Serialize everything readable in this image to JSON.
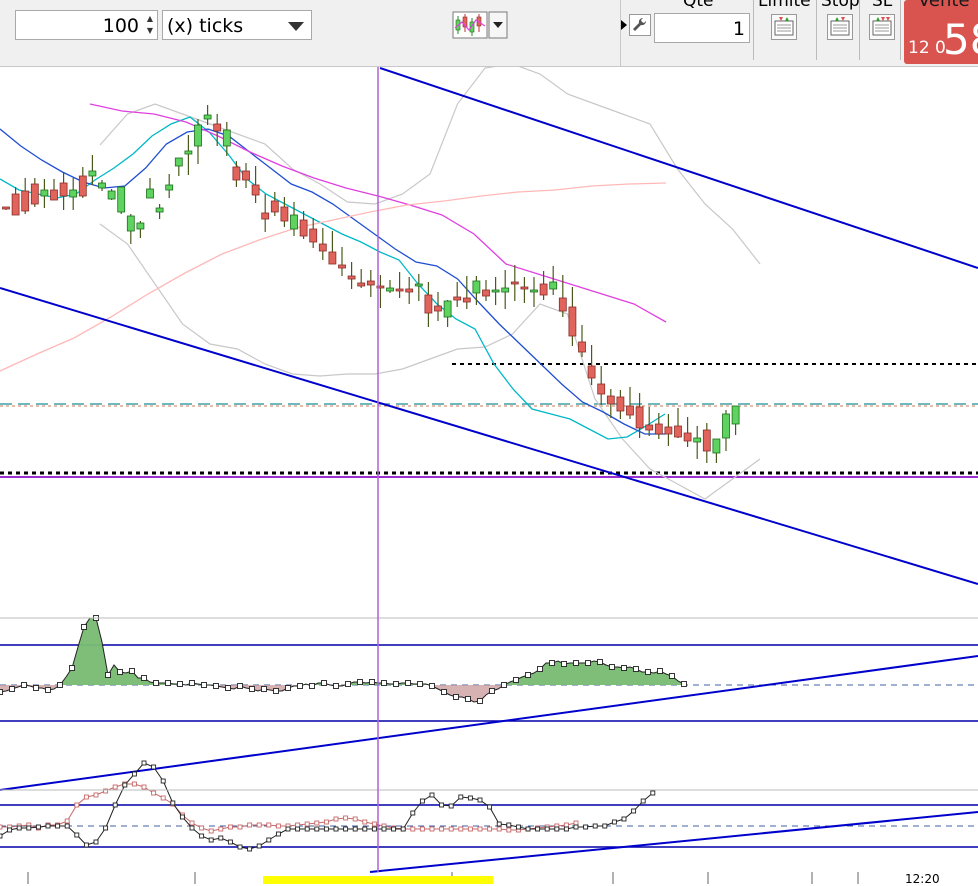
{
  "toolbar": {
    "count_value": "100",
    "unit_label": "(x) ticks",
    "indicator_button": "indicator-selector-icon"
  },
  "order_panel": {
    "qty_header": "Qté",
    "qty_value": "1",
    "limit_header": "Limite",
    "stop_header": "Stop",
    "sl_header": "SL",
    "sell_header": "Vente",
    "sell_price_small": "12 0",
    "sell_price_big": "58"
  },
  "axis": {
    "date_label": "12:20"
  },
  "colors": {
    "bull": "#5fd35f",
    "bear": "#e0645c",
    "trend_line": "#0000cc",
    "ma_fast": "#00b8c8",
    "ma_mid": "#1f4fd0",
    "ma_slow": "#e040e0",
    "ma_long": "#ffb8b8",
    "band": "#c8c8c8",
    "cursor": "#b060d8"
  },
  "chart_data": [
    {
      "type": "candlestick",
      "title": "",
      "candles": [
        {
          "o": 57,
          "h": 55,
          "l": 54,
          "c": 56
        },
        {
          "o": 70,
          "h": 77,
          "l": 49,
          "c": 49
        },
        {
          "o": 73,
          "h": 86,
          "l": 50,
          "c": 53
        },
        {
          "o": 80,
          "h": 86,
          "l": 57,
          "c": 60
        },
        {
          "o": 68,
          "h": 85,
          "l": 56,
          "c": 74
        },
        {
          "o": 74,
          "h": 85,
          "l": 64,
          "c": 64
        },
        {
          "o": 81,
          "h": 92,
          "l": 54,
          "c": 68
        },
        {
          "o": 67,
          "h": 86,
          "l": 54,
          "c": 74
        },
        {
          "o": 88,
          "h": 97,
          "l": 66,
          "c": 68
        },
        {
          "o": 88,
          "h": 109,
          "l": 79,
          "c": 93
        },
        {
          "o": 76,
          "h": 84,
          "l": 73,
          "c": 81
        },
        {
          "o": 65,
          "h": 75,
          "l": 64,
          "c": 73
        },
        {
          "o": 52,
          "h": 76,
          "l": 50,
          "c": 77
        },
        {
          "o": 33,
          "h": 50,
          "l": 20,
          "c": 48
        },
        {
          "o": 35,
          "h": 43,
          "l": 26,
          "c": 41
        },
        {
          "o": 66,
          "h": 86,
          "l": 68,
          "c": 75
        },
        {
          "o": 52,
          "h": 60,
          "l": 45,
          "c": 56
        },
        {
          "o": 74,
          "h": 90,
          "l": 66,
          "c": 79
        },
        {
          "o": 98,
          "h": 100,
          "l": 88,
          "c": 106
        },
        {
          "o": 110,
          "h": 129,
          "l": 89,
          "c": 113
        },
        {
          "o": 118,
          "h": 145,
          "l": 100,
          "c": 139
        },
        {
          "o": 145,
          "h": 159,
          "l": 139,
          "c": 149
        },
        {
          "o": 140,
          "h": 150,
          "l": 118,
          "c": 133
        },
        {
          "o": 118,
          "h": 142,
          "l": 108,
          "c": 134
        },
        {
          "o": 97,
          "h": 103,
          "l": 77,
          "c": 84
        },
        {
          "o": 93,
          "h": 101,
          "l": 76,
          "c": 84
        },
        {
          "o": 79,
          "h": 98,
          "l": 61,
          "c": 69
        },
        {
          "o": 51,
          "h": 70,
          "l": 32,
          "c": 45
        },
        {
          "o": 63,
          "h": 72,
          "l": 48,
          "c": 52
        },
        {
          "o": 57,
          "h": 67,
          "l": 37,
          "c": 43
        },
        {
          "o": 35,
          "h": 62,
          "l": 28,
          "c": 49
        },
        {
          "o": 44,
          "h": 53,
          "l": 25,
          "c": 28
        },
        {
          "o": 35,
          "h": 46,
          "l": 16,
          "c": 22
        },
        {
          "o": 20,
          "h": 36,
          "l": 4,
          "c": 13
        },
        {
          "o": 12,
          "h": 33,
          "l": 1,
          "c": 0
        },
        {
          "o": -1,
          "h": 17,
          "l": -12,
          "c": -4
        },
        {
          "o": -12,
          "h": 2,
          "l": -25,
          "c": -15
        },
        {
          "o": -19,
          "h": -5,
          "l": -24,
          "c": -22
        },
        {
          "o": -17,
          "h": -6,
          "l": -33,
          "c": -21
        },
        {
          "o": -22,
          "h": -11,
          "l": -44,
          "c": -24
        },
        {
          "o": -27,
          "h": -16,
          "l": -29,
          "c": -24
        },
        {
          "o": -25,
          "h": -8,
          "l": -34,
          "c": -26
        },
        {
          "o": -25,
          "h": -13,
          "l": -40,
          "c": -28
        },
        {
          "o": -22,
          "h": -10,
          "l": -37,
          "c": -20
        },
        {
          "o": -31,
          "h": -18,
          "l": -63,
          "c": -49
        },
        {
          "o": -42,
          "h": -28,
          "l": -57,
          "c": -47
        },
        {
          "o": -53,
          "h": -36,
          "l": -63,
          "c": -37
        },
        {
          "o": -33,
          "h": -18,
          "l": -43,
          "c": -36
        },
        {
          "o": -34,
          "h": -12,
          "l": -45,
          "c": -38
        },
        {
          "o": -29,
          "h": -12,
          "l": -41,
          "c": -17
        },
        {
          "o": -26,
          "h": -16,
          "l": -37,
          "c": -32
        },
        {
          "o": -26,
          "h": -13,
          "l": -41,
          "c": -26
        },
        {
          "o": -28,
          "h": -6,
          "l": -45,
          "c": -24
        },
        {
          "o": -18,
          "h": -1,
          "l": -37,
          "c": -19
        },
        {
          "o": -23,
          "h": -13,
          "l": -39,
          "c": -25
        },
        {
          "o": -26,
          "h": -13,
          "l": -43,
          "c": -26
        },
        {
          "o": -20,
          "h": -7,
          "l": -36,
          "c": -31
        },
        {
          "o": -25,
          "h": -2,
          "l": -31,
          "c": -18
        },
        {
          "o": -34,
          "h": -11,
          "l": -53,
          "c": -47
        },
        {
          "o": -43,
          "h": -23,
          "l": -82,
          "c": -72
        },
        {
          "o": -78,
          "h": -61,
          "l": -93,
          "c": -88
        },
        {
          "o": -102,
          "h": -81,
          "l": -121,
          "c": -114
        },
        {
          "o": -120,
          "h": -102,
          "l": -141,
          "c": -130
        },
        {
          "o": -132,
          "h": -125,
          "l": -154,
          "c": -140
        },
        {
          "o": -133,
          "h": -126,
          "l": -155,
          "c": -147
        },
        {
          "o": -142,
          "h": -123,
          "l": -155,
          "c": -151
        },
        {
          "o": -143,
          "h": -129,
          "l": -174,
          "c": -164
        },
        {
          "o": -161,
          "h": -143,
          "l": -172,
          "c": -166
        },
        {
          "o": -160,
          "h": -149,
          "l": -175,
          "c": -170
        },
        {
          "o": -163,
          "h": -150,
          "l": -182,
          "c": -170
        },
        {
          "o": -162,
          "h": -144,
          "l": -174,
          "c": -173
        },
        {
          "o": -169,
          "h": -153,
          "l": -183,
          "c": -177
        },
        {
          "o": -178,
          "h": -162,
          "l": -195,
          "c": -174
        },
        {
          "o": -166,
          "h": -159,
          "l": -199,
          "c": -187
        },
        {
          "o": -189,
          "h": -178,
          "l": -199,
          "c": -175
        },
        {
          "o": -174,
          "h": -146,
          "l": -187,
          "c": -150
        },
        {
          "o": -160,
          "h": -144,
          "l": -171,
          "c": -142
        }
      ],
      "bands": [
        {
          "name": "upper",
          "values": [
            119,
            150,
            160,
            150,
            140,
            130,
            120,
            95,
            80,
            62,
            60,
            70,
            90,
            160,
            196,
            200,
            190,
            170,
            160,
            150,
            140,
            95,
            60,
            35,
            0
          ]
        },
        {
          "name": "lower",
          "values": [
            40,
            20,
            -20,
            -60,
            -80,
            -85,
            -100,
            -110,
            -112,
            -110,
            -110,
            -105,
            -95,
            -85,
            -83,
            -70,
            -40,
            -50,
            -135,
            -175,
            -205,
            -220,
            -235,
            -215,
            -195
          ]
        }
      ],
      "moving_averages": [
        {
          "name": "ma-fast",
          "values": [
            85,
            74,
            70,
            66,
            70,
            84,
            96,
            110,
            128,
            140,
            147,
            132,
            110,
            85,
            70,
            60,
            50,
            40,
            30,
            22,
            12,
            4,
            -20,
            -40,
            -55,
            -65,
            -100,
            -125,
            -145,
            -150,
            -155,
            -165,
            -175,
            -173,
            -162,
            -150
          ]
        },
        {
          "name": "ma-mid",
          "values": [
            135,
            118,
            104,
            92,
            82,
            76,
            78,
            96,
            120,
            132,
            135,
            128,
            112,
            96,
            80,
            72,
            60,
            45,
            30,
            15,
            2,
            -2,
            -15,
            -38,
            -60,
            -80,
            -100,
            -120,
            -138,
            -148,
            -160,
            -170,
            -170
          ]
        },
        {
          "name": "ma-slow",
          "values": [
            160,
            153,
            150,
            142,
            128,
            112,
            98,
            86,
            76,
            68,
            59,
            49,
            30,
            0,
            -10,
            -20,
            -30,
            -40,
            -58
          ]
        },
        {
          "name": "ma-long",
          "values": [
            -107,
            -90,
            -74,
            -53,
            -30,
            -9,
            10,
            24,
            36,
            44,
            52,
            59,
            63,
            68,
            72,
            74,
            78,
            80,
            81
          ]
        }
      ],
      "horizontal_levels": [
        {
          "name": "dotted-upper",
          "value": -100
        },
        {
          "name": "dashed-cyan",
          "value": -140
        },
        {
          "name": "dashed-brown",
          "value": -142
        },
        {
          "name": "dotted-lower",
          "value": -209
        },
        {
          "name": "solid-purple",
          "value": -213
        }
      ]
    },
    {
      "type": "line",
      "title": "",
      "series": [
        {
          "values": [
            7,
            6,
            4,
            2,
            0,
            1,
            3,
            3,
            5,
            4,
            0,
            -8,
            -17,
            -38,
            -58,
            -67,
            -67,
            -43,
            -10,
            -20,
            -13,
            -12,
            -14,
            -7,
            -7,
            -3,
            -2,
            -2,
            -2,
            -1,
            -1,
            0,
            -2,
            -1,
            0,
            0,
            1,
            2,
            3,
            4,
            1,
            3,
            4,
            6,
            4,
            5,
            6,
            6,
            3,
            1,
            1,
            -1,
            1,
            -2,
            -2,
            0,
            1,
            1,
            -1,
            -3,
            -3,
            -2,
            -3,
            -2,
            -2,
            -1,
            -1,
            -2,
            -2,
            -1,
            -1,
            -1,
            1,
            4,
            7,
            10,
            12,
            12,
            14,
            17,
            16,
            10,
            6,
            4,
            0,
            -3,
            -5,
            -8,
            -10,
            -12,
            -16,
            -22,
            -22,
            -24,
            -21,
            -22,
            -22,
            -22,
            -22,
            -24,
            -23,
            -20,
            -18,
            -18,
            -17,
            -18,
            -16,
            -13,
            -13,
            -12,
            -14,
            -11,
            -9,
            -4,
            -1
          ]
        },
        {
          "values": []
        }
      ]
    },
    {
      "type": "line",
      "title": "",
      "series": [
        {
          "values": [
            -10,
            -4,
            -2,
            -2,
            -1,
            0,
            0,
            0,
            -9,
            -19,
            -16,
            -2,
            21,
            41,
            52,
            63,
            59,
            45,
            23,
            9,
            -2,
            -10,
            -14,
            -12,
            -16,
            -21,
            -23,
            -20,
            -14,
            -8,
            -3,
            -3,
            -3,
            -3,
            -3,
            -3,
            -3,
            -3,
            -3,
            -3,
            -3,
            -3,
            -3,
            13,
            25,
            31,
            21,
            20,
            29,
            28,
            26,
            19,
            2,
            1,
            -1,
            -3,
            -3,
            -3,
            -3,
            -3,
            -1,
            -1,
            0,
            0,
            4,
            7,
            15,
            25,
            33
          ]
        },
        {
          "values": [
            -1,
            -1,
            0,
            1,
            -2,
            1,
            1,
            5,
            21,
            29,
            31,
            35,
            39,
            42,
            42,
            39,
            33,
            28,
            22,
            11,
            3,
            -2,
            -5,
            -3,
            -1,
            -1,
            1,
            1,
            1,
            0,
            0,
            1,
            2,
            3,
            4,
            7,
            8,
            7,
            4,
            2,
            0,
            -2,
            -3,
            -3,
            -3,
            -3,
            -3,
            -3,
            -3,
            -3,
            -3,
            -3,
            -3,
            -4,
            -4,
            -3,
            -2,
            -1,
            0,
            1,
            3
          ]
        }
      ]
    }
  ]
}
